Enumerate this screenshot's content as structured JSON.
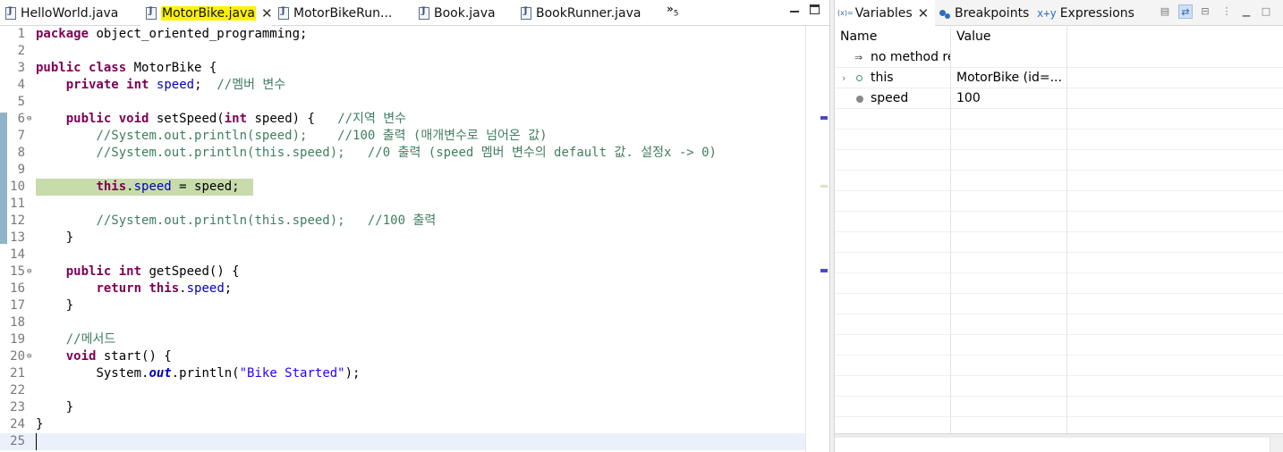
{
  "editor": {
    "tabs": [
      {
        "label": "HelloWorld.java",
        "active": false
      },
      {
        "label": "MotorBike.java",
        "active": true,
        "close": "✕"
      },
      {
        "label": "MotorBikeRun...",
        "active": false
      },
      {
        "label": "Book.java",
        "active": false
      },
      {
        "label": "BookRunner.java",
        "active": false
      }
    ],
    "overflow_label": "»",
    "overflow_count": "5",
    "line_numbers": [
      "1",
      "2",
      "3",
      "4",
      "5",
      "6",
      "7",
      "8",
      "9",
      "10",
      "11",
      "12",
      "13",
      "14",
      "15",
      "16",
      "17",
      "18",
      "19",
      "20",
      "21",
      "22",
      "23",
      "24",
      "25"
    ]
  },
  "code_lines": {
    "l1_kw": "package",
    "l1_rest": " object_oriented_programming;",
    "l3_kw1": "public",
    "l3_kw2": "class",
    "l3_rest": " MotorBike {",
    "l4_kw1": "private",
    "l4_kw2": "int",
    "l4_fld": "speed",
    "l4_rest": ";  ",
    "l4_cm": "//멤버 변수",
    "l6_kw1": "public",
    "l6_kw2": "void",
    "l6_mid": " setSpeed(",
    "l6_kw3": "int",
    "l6_rest": " speed) {   ",
    "l6_cm": "//지역 변수",
    "l7_cm": "//System.out.println(speed);    //100 출력 (매개변수로 넘어온 값)",
    "l8_cm": "//System.out.println(this.speed);   //0 출력 (speed 멤버 변수의 default 값. 설정x -> 0)",
    "l10_kw": "this",
    "l10_dot": ".",
    "l10_fld": "speed",
    "l10_rest": " = speed;",
    "l12_cm": "//System.out.println(this.speed);   //100 출력",
    "l13": "}",
    "l15_kw1": "public",
    "l15_kw2": "int",
    "l15_rest": " getSpeed() {",
    "l16_kw1": "return",
    "l16_kw2": "this",
    "l16_dot": ".",
    "l16_fld": "speed",
    "l16_rest": ";",
    "l17": "}",
    "l19_cm": "//메서드",
    "l20_kw": "void",
    "l20_rest": " start() {",
    "l21_pre": "System.",
    "l21_sfld": "out",
    "l21_mid": ".println(",
    "l21_str": "\"Bike Started\"",
    "l21_rest": ");",
    "l23": "}",
    "l24": "}"
  },
  "variables_view": {
    "tabs": [
      {
        "label": "Variables",
        "icon_text": "(x)=",
        "close": "✕",
        "active": true
      },
      {
        "label": "Breakpoints",
        "active": false
      },
      {
        "label": "Expressions",
        "icon_text": "x+y",
        "active": false
      }
    ],
    "columns": [
      "Name",
      "Value"
    ],
    "rows": [
      {
        "name": "no method re",
        "value": "",
        "icon": "return-icon"
      },
      {
        "name": "this",
        "value": "MotorBike  (id=...",
        "icon": "object-icon",
        "expander": "›"
      },
      {
        "name": "speed",
        "value": "100",
        "icon": "private-field-icon"
      }
    ]
  },
  "colors": {
    "keyword": "#7f0055",
    "field": "#0000c0",
    "comment": "#3f7f5f",
    "string": "#2a00ff",
    "debug_line_highlight": "#c8dcab",
    "active_tab_highlight": "#fff200"
  }
}
